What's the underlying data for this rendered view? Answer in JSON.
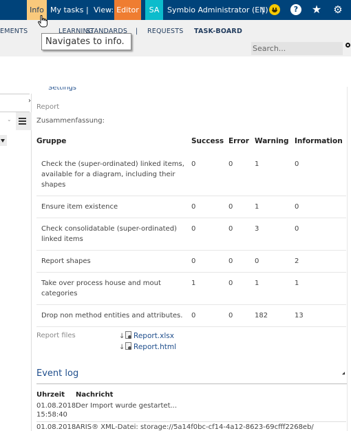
{
  "topbar": {
    "info": "Info",
    "my_tasks": "My tasks",
    "separator": "|",
    "view_label": "View:",
    "view_mode": "Editor",
    "user_initials": "SA",
    "user_name": "Symbio Administrator (EN)",
    "colors": {
      "bar": "#00437a",
      "info_active": "#f9c97c",
      "editor": "#ef7d31",
      "avatar": "#0cbccc"
    }
  },
  "tooltip": "Navigates to info.",
  "nav": {
    "items": [
      "EMENTS",
      "LEARNING",
      "STANDARDS",
      "|",
      "REQUESTS",
      "TASK-BOARD"
    ],
    "active": "TASK-BOARD"
  },
  "search": {
    "placeholder": "Search..."
  },
  "main": {
    "settings_link": "Settings",
    "report_label": "Report",
    "summary_label": "Zusammenfassung:",
    "table": {
      "headers": [
        "Gruppe",
        "Success",
        "Error",
        "Warning",
        "Information"
      ],
      "rows": [
        {
          "group": "Check the (super-ordinated) linked items, available for a diagram, including their shapes",
          "success": "0",
          "error": "0",
          "warning": "1",
          "information": "0"
        },
        {
          "group": "Ensure item existence",
          "success": "0",
          "error": "0",
          "warning": "1",
          "information": "0"
        },
        {
          "group": "Check consolidatable (super-ordinated) linked items",
          "success": "0",
          "error": "0",
          "warning": "3",
          "information": "0"
        },
        {
          "group": "Report shapes",
          "success": "0",
          "error": "0",
          "warning": "0",
          "information": "2"
        },
        {
          "group": "Take over process house and mout categories",
          "success": "1",
          "error": "0",
          "warning": "1",
          "information": "1"
        },
        {
          "group": "Drop non method entities and attributes.",
          "success": "0",
          "error": "0",
          "warning": "182",
          "information": "13"
        }
      ]
    },
    "report_files_label": "Report files",
    "files": [
      "Report.xlsx",
      "Report.html"
    ],
    "event_log": {
      "title": "Event log",
      "headers": [
        "Uhrzeit",
        "Nachricht"
      ],
      "rows": [
        {
          "time": "01.08.2018 15:58:40",
          "message": "Der Import wurde gestartet..."
        },
        {
          "time": "01.08.2018",
          "message": "ARIS® XML-Datei: storage://5a14f0bc-cf14-4a12-8623-69cfff2268eb/"
        }
      ]
    }
  }
}
